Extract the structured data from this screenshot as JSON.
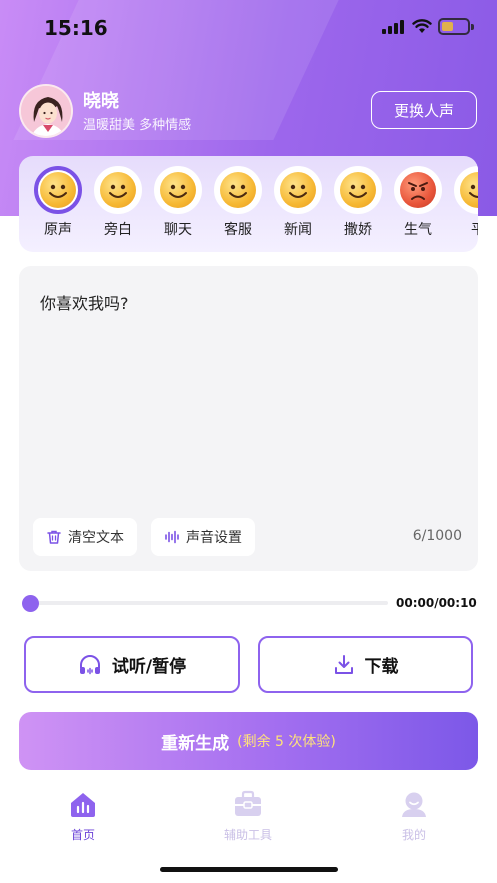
{
  "status_bar": {
    "time": "15:16"
  },
  "voice": {
    "name": "晓晓",
    "description": "温暖甜美 多种情感",
    "change_label": "更换人声"
  },
  "emotions": {
    "items": [
      {
        "label": "原声",
        "icon": "smiley-face-icon",
        "selected": true
      },
      {
        "label": "旁白",
        "icon": "smiley-face-icon"
      },
      {
        "label": "聊天",
        "icon": "smiley-face-icon"
      },
      {
        "label": "客服",
        "icon": "smiley-face-icon"
      },
      {
        "label": "新闻",
        "icon": "smiley-face-icon"
      },
      {
        "label": "撒娇",
        "icon": "smiley-face-icon"
      },
      {
        "label": "生气",
        "icon": "angry-face-icon"
      },
      {
        "label": "平",
        "icon": "smiley-face-icon"
      }
    ]
  },
  "editor": {
    "text": "你喜欢我吗?",
    "clear_label": "清空文本",
    "sound_settings_label": "声音设置",
    "char_count": "6/1000"
  },
  "player": {
    "progress": 0,
    "time": "00:00/00:10"
  },
  "actions": {
    "preview_label": "试听/暂停",
    "download_label": "下载",
    "regenerate_label": "重新生成",
    "regenerate_remaining": "(剩余 5 次体验)"
  },
  "tabbar": {
    "items": [
      {
        "label": "首页",
        "icon": "home-chart-icon",
        "active": true
      },
      {
        "label": "辅助工具",
        "icon": "toolbox-icon",
        "active": false
      },
      {
        "label": "我的",
        "icon": "profile-icon",
        "active": false
      }
    ]
  },
  "colors": {
    "accent": "#8e63ee",
    "hero_start": "#c98cf6",
    "hero_end": "#8a5ae6",
    "remaining_text": "#ffe27a"
  }
}
